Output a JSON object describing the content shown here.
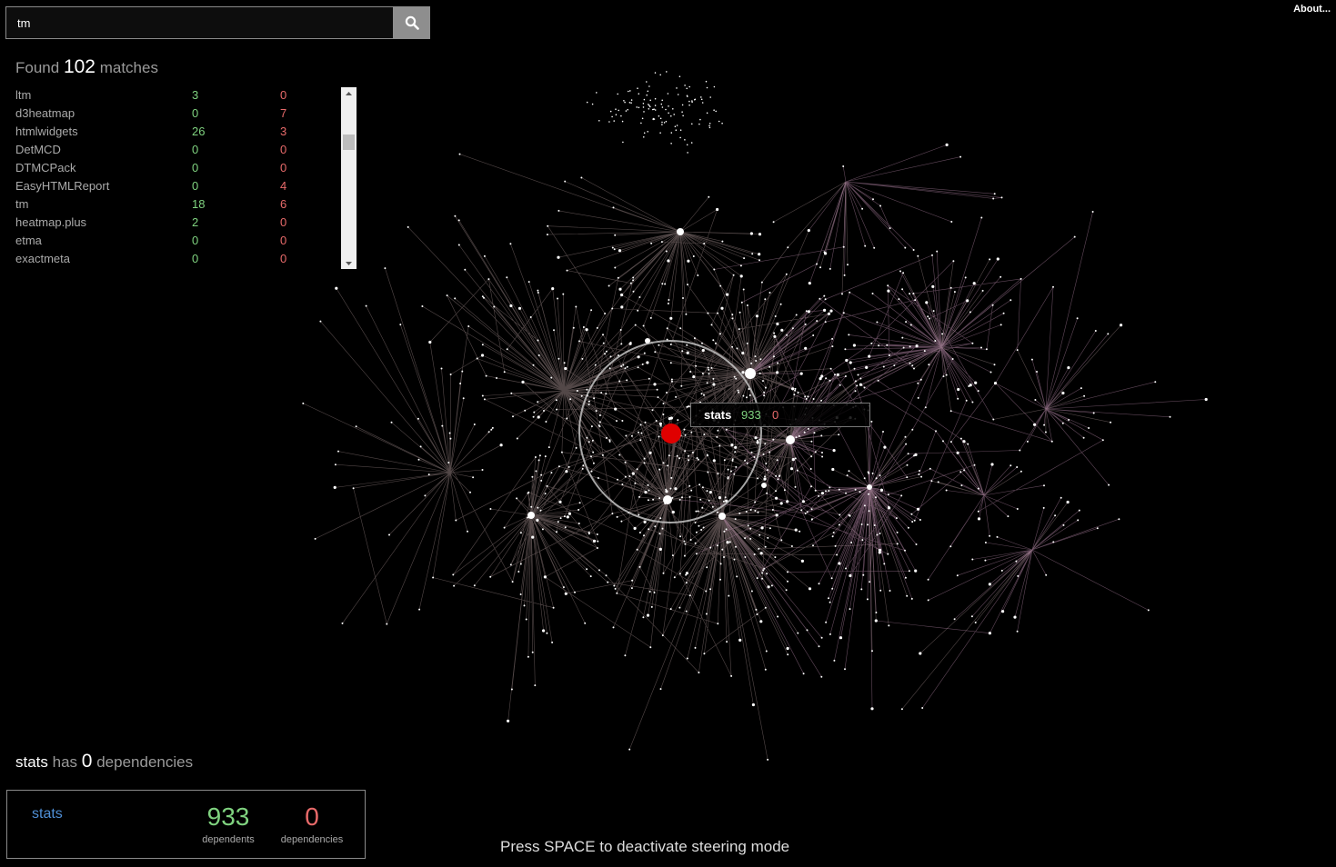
{
  "search": {
    "value": "tm",
    "button_icon": "search-icon"
  },
  "about_label": "About...",
  "results": {
    "found_prefix": "Found",
    "count": "102",
    "found_suffix": "matches",
    "items": [
      {
        "name": "ltm",
        "dependents": "3",
        "dependencies": "0"
      },
      {
        "name": "d3heatmap",
        "dependents": "0",
        "dependencies": "7"
      },
      {
        "name": "htmlwidgets",
        "dependents": "26",
        "dependencies": "3"
      },
      {
        "name": "DetMCD",
        "dependents": "0",
        "dependencies": "0"
      },
      {
        "name": "DTMCPack",
        "dependents": "0",
        "dependencies": "0"
      },
      {
        "name": "EasyHTMLReport",
        "dependents": "0",
        "dependencies": "4"
      },
      {
        "name": "tm",
        "dependents": "18",
        "dependencies": "6"
      },
      {
        "name": "heatmap.plus",
        "dependents": "2",
        "dependencies": "0"
      },
      {
        "name": "etma",
        "dependents": "0",
        "dependencies": "0"
      },
      {
        "name": "exactmeta",
        "dependents": "0",
        "dependencies": "0"
      }
    ]
  },
  "tooltip": {
    "name": "stats",
    "dependents": "933",
    "dependencies": "0"
  },
  "selected": {
    "name": "stats",
    "has_word": "has",
    "dep_count": "0",
    "dep_word": "dependencies",
    "dependents": "933",
    "dependents_label": "dependents",
    "dependencies": "0",
    "dependencies_label": "dependencies"
  },
  "hint": "Press SPACE to deactivate steering mode",
  "colors": {
    "green": "#7fd27f",
    "red": "#e86a6a",
    "link": "#4f8fd6",
    "highlight": "#e00000"
  }
}
